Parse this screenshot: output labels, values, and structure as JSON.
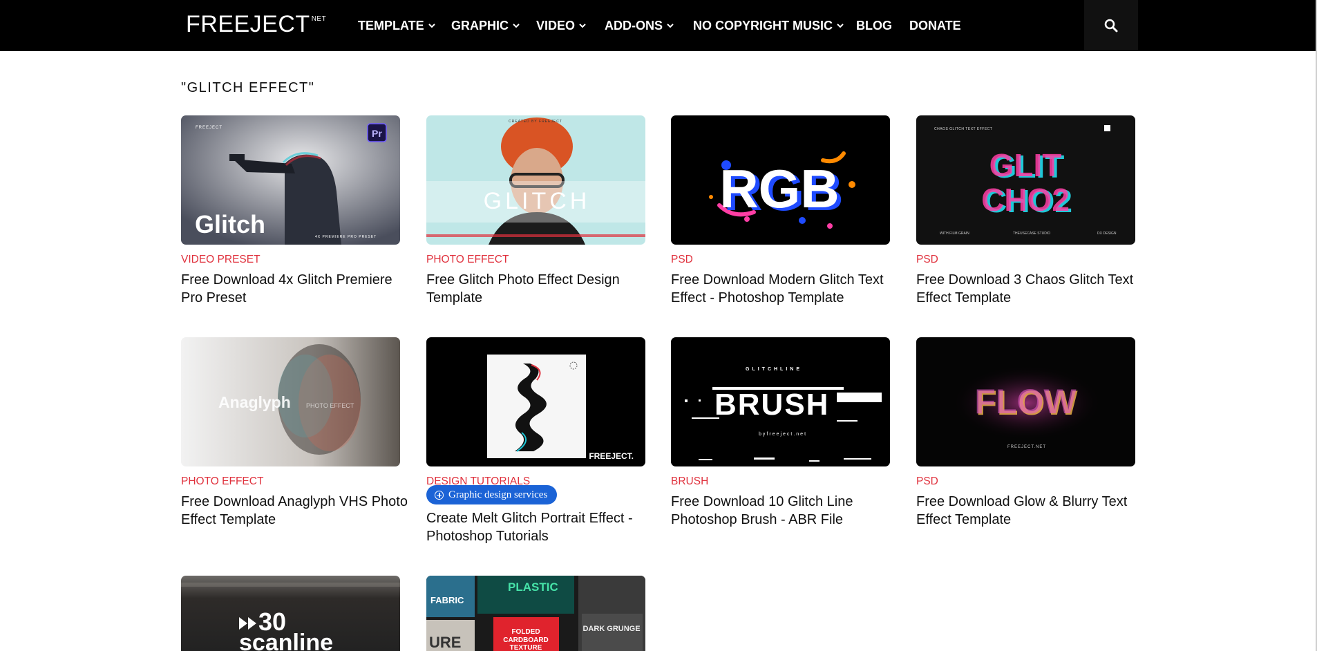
{
  "header": {
    "logo_text": "FREEJECT",
    "logo_suffix": "NET",
    "nav": [
      {
        "label": "TEMPLATE",
        "dropdown": true
      },
      {
        "label": "GRAPHIC",
        "dropdown": true
      },
      {
        "label": "VIDEO",
        "dropdown": true
      },
      {
        "label": "ADD-ONS",
        "dropdown": true
      },
      {
        "label": "NO COPYRIGHT MUSIC",
        "dropdown": true
      },
      {
        "label": "BLOG",
        "dropdown": false
      },
      {
        "label": "DONATE",
        "dropdown": false
      }
    ],
    "search_icon": "search-icon"
  },
  "page": {
    "heading": "\"GLITCH EFFECT\""
  },
  "cards": [
    {
      "category": "VIDEO PRESET",
      "title": "Free Download 4x Glitch Premiere Pro Preset",
      "thumb": {
        "brand": "FREEJECT",
        "badge": "Pr",
        "main": "Glitch",
        "sub": "4X PREMIERE PRO PRESET"
      }
    },
    {
      "category": "PHOTO EFFECT",
      "title": "Free Glitch Photo Effect Design Template",
      "thumb": {
        "top": "CREATED BY FREEJECT",
        "main": "GLITCH"
      }
    },
    {
      "category": "PSD",
      "title": "Free Download Modern Glitch Text Effect - Photoshop Template",
      "thumb": {
        "main": "RGB"
      }
    },
    {
      "category": "PSD",
      "title": "Free Download 3 Chaos Glitch Text Effect Template",
      "thumb": {
        "top": "CHAOS GLITCH TEXT EFFECT",
        "main1": "GLIT",
        "main2": "CHO2",
        "f1": "WITH FILM GRAIN",
        "f2": "THEUSECASE STUDIO",
        "f3": "DX DESIGN"
      }
    },
    {
      "category": "PHOTO EFFECT",
      "title": "Free Download Anaglyph VHS Photo Effect Template",
      "thumb": {
        "main": "Anaglyph",
        "sub": "PHOTO EFFECT"
      }
    },
    {
      "category": "DESIGN TUTORIALS",
      "title": "Create Melt Glitch Portrait Effect - Photoshop Tutorials",
      "thumb": {
        "brand": "FREEJECT."
      }
    },
    {
      "category": "BRUSH",
      "title": "Free Download 10 Glitch Line Photoshop Brush - ABR File",
      "thumb": {
        "top": "GLITCHLINE",
        "main": "BRUSH",
        "sub": "byfreeject.net"
      }
    },
    {
      "category": "PSD",
      "title": "Free Download Glow & Blurry Text Effect Template",
      "thumb": {
        "main": "FLOW",
        "sub": "FREEJECT.NET"
      }
    },
    {
      "thumb": {
        "main1": "30",
        "main2": "scanline"
      }
    },
    {
      "thumb": {
        "t1": "PLASTIC",
        "t2": "FABRIC",
        "t3": "FOLDED",
        "t4": "CARDBOARD",
        "t5": "TEXTURE",
        "t6": "DARK GRUNGE",
        "t7": "URE"
      }
    }
  ],
  "badge": {
    "label": "Graphic design services",
    "icon": "plus-circle-icon"
  },
  "colors": {
    "header_bg": "#000000",
    "category": "#e0313d",
    "badge": "#1b63d6"
  }
}
